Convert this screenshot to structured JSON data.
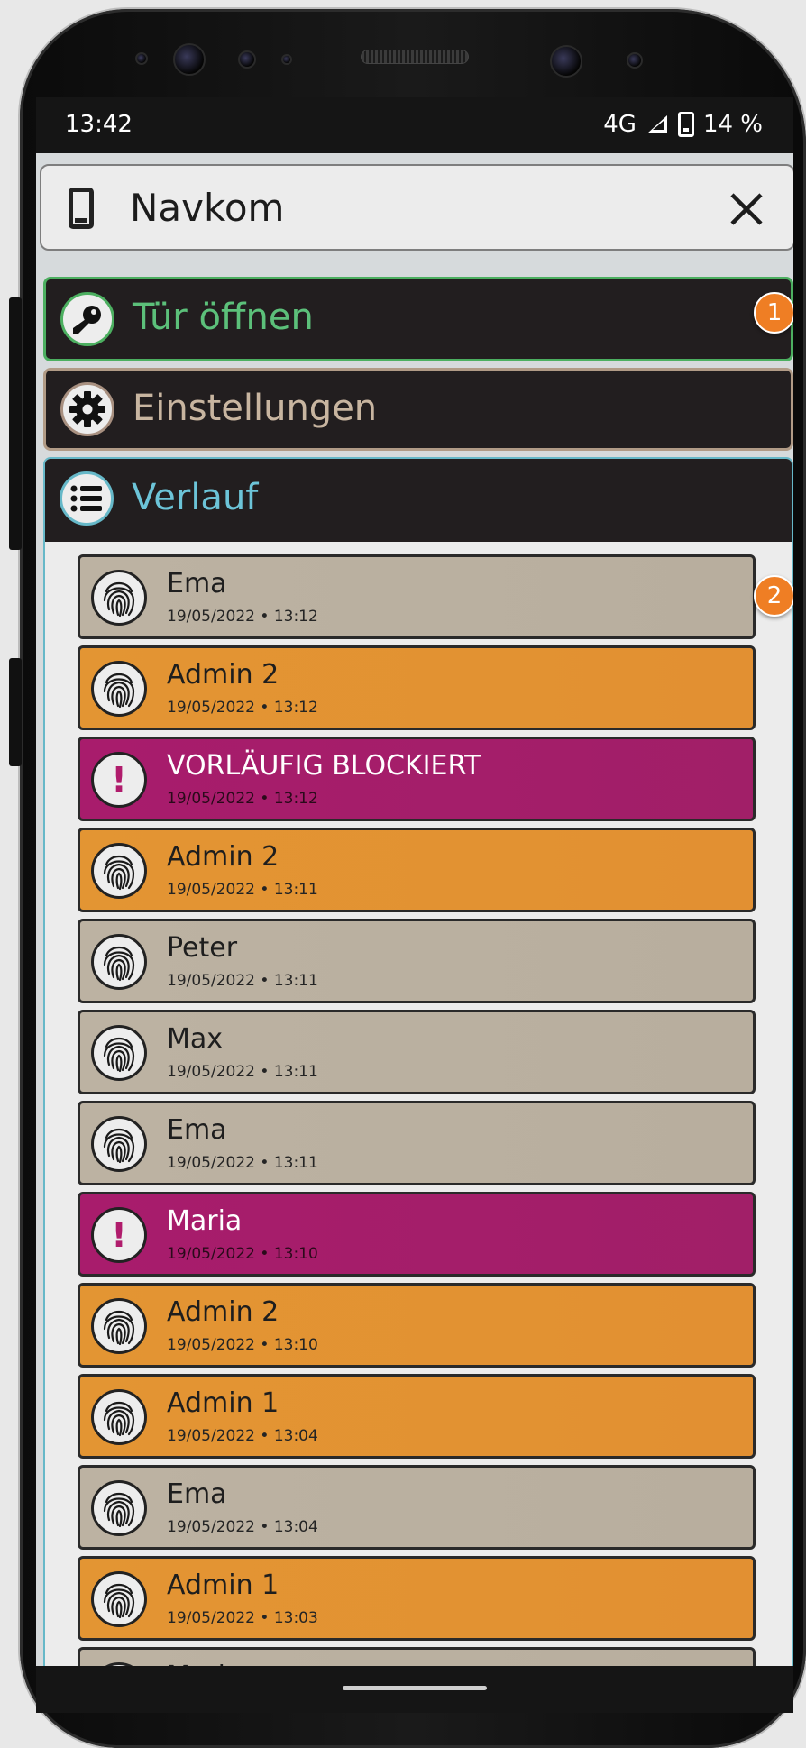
{
  "status_bar": {
    "time": "13:42",
    "network": "4G",
    "battery": "14 %"
  },
  "header": {
    "title": "Navkom",
    "icon": "smartphone-icon",
    "close_icon": "close-icon"
  },
  "menu": {
    "open_door": {
      "label": "Tür öffnen",
      "icon": "key-icon",
      "color": "#5cc07a",
      "badge": "1"
    },
    "settings": {
      "label": "Einstellungen",
      "icon": "gear-icon",
      "color": "#c8b5a0"
    },
    "history": {
      "label": "Verlauf",
      "icon": "list-icon",
      "color": "#6cc4d8",
      "badge": "2"
    }
  },
  "history_entries": [
    {
      "name": "Ema",
      "timestamp": "19/05/2022 • 13:12",
      "type": "gray",
      "icon": "fingerprint-icon"
    },
    {
      "name": "Admin 2",
      "timestamp": "19/05/2022 • 13:12",
      "type": "orange",
      "icon": "fingerprint-icon"
    },
    {
      "name": "VORLÄUFIG BLOCKIERT",
      "timestamp": "19/05/2022 • 13:12",
      "type": "magenta",
      "icon": "alert-icon"
    },
    {
      "name": "Admin 2",
      "timestamp": "19/05/2022 • 13:11",
      "type": "orange",
      "icon": "fingerprint-icon"
    },
    {
      "name": "Peter",
      "timestamp": "19/05/2022 • 13:11",
      "type": "gray",
      "icon": "fingerprint-icon"
    },
    {
      "name": "Max",
      "timestamp": "19/05/2022 • 13:11",
      "type": "gray",
      "icon": "fingerprint-icon"
    },
    {
      "name": "Ema",
      "timestamp": "19/05/2022 • 13:11",
      "type": "gray",
      "icon": "fingerprint-icon"
    },
    {
      "name": "Maria",
      "timestamp": "19/05/2022 • 13:10",
      "type": "magenta",
      "icon": "alert-icon"
    },
    {
      "name": "Admin 2",
      "timestamp": "19/05/2022 • 13:10",
      "type": "orange",
      "icon": "fingerprint-icon"
    },
    {
      "name": "Admin 1",
      "timestamp": "19/05/2022 • 13:04",
      "type": "orange",
      "icon": "fingerprint-icon"
    },
    {
      "name": "Ema",
      "timestamp": "19/05/2022 • 13:04",
      "type": "gray",
      "icon": "fingerprint-icon"
    },
    {
      "name": "Admin 1",
      "timestamp": "19/05/2022 • 13:03",
      "type": "orange",
      "icon": "fingerprint-icon"
    },
    {
      "name": "Maria",
      "timestamp": "",
      "type": "gray",
      "icon": "fingerprint-icon"
    }
  ],
  "colors": {
    "gray": "#bcb2a2",
    "orange": "#e39533",
    "magenta": "#a81c6c",
    "badge": "#ef7e24"
  }
}
